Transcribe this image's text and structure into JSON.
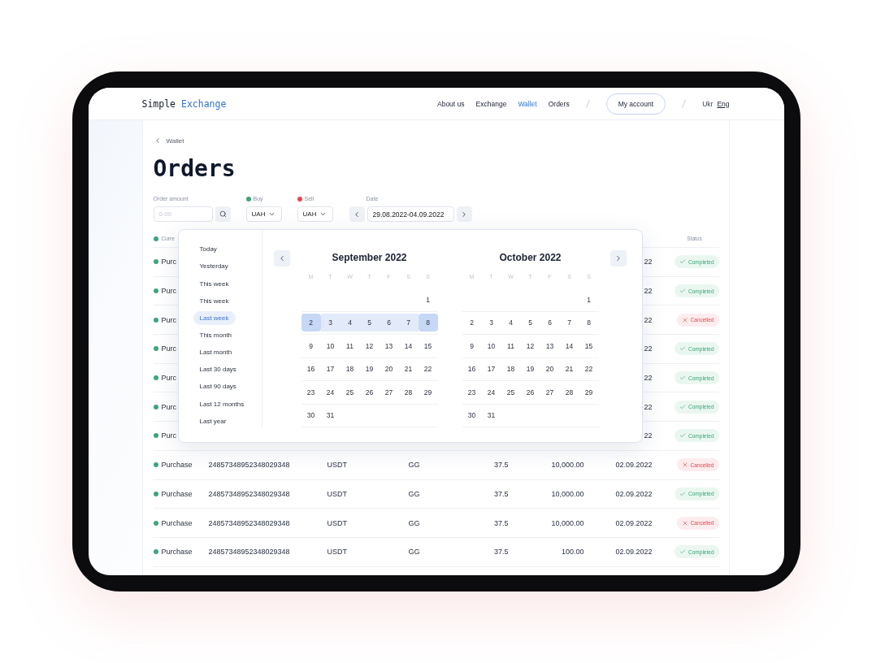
{
  "header": {
    "logo": {
      "first": "Simple",
      "second": "Exchange"
    },
    "nav": [
      {
        "label": "About us",
        "selected": false
      },
      {
        "label": "Exchange",
        "selected": false
      },
      {
        "label": "Wallet",
        "selected": true
      },
      {
        "label": "Orders",
        "selected": false
      }
    ],
    "account_button": "My account",
    "languages": [
      {
        "label": "Ukr",
        "selected": false
      },
      {
        "label": "Eng",
        "selected": true
      }
    ]
  },
  "breadcrumb": "Wallet",
  "title": "Orders",
  "filters": {
    "amount": {
      "label": "Order amount",
      "placeholder": "0.00"
    },
    "currencies": [
      {
        "label": "Buy",
        "value": "UAH",
        "color": "#3fa57c"
      },
      {
        "label": "Sell",
        "value": "UAH",
        "color": "#e5484d"
      }
    ],
    "date": {
      "label": "Date",
      "value": "29.08.2022-04.09.2022"
    }
  },
  "table": {
    "header": {
      "column_1": "Curre",
      "status": "Status"
    },
    "rows": [
      {
        "type": "Purc",
        "date": "22",
        "kind": "completed",
        "status_label": "Completed"
      },
      {
        "type": "Purc",
        "date": "22",
        "kind": "completed",
        "status_label": "Completed"
      },
      {
        "type": "Purc",
        "date": "22",
        "kind": "cancelled",
        "status_label": "Cancelled"
      },
      {
        "type": "Purc",
        "date": "22",
        "kind": "completed",
        "status_label": "Completed"
      },
      {
        "type": "Purc",
        "date": "22",
        "kind": "completed",
        "status_label": "Completed"
      },
      {
        "type": "Purc",
        "date": "22",
        "kind": "completed",
        "status_label": "Completed"
      },
      {
        "type": "Purc",
        "date": "22",
        "kind": "completed",
        "status_label": "Completed"
      },
      {
        "type": "Purchase",
        "id": "24857348952348029348",
        "currency": "USDT",
        "column_4": "GG",
        "rate": "37.5",
        "amount": "10,000.00",
        "date": "02.09.2022",
        "kind": "cancelled",
        "status_label": "Cancelled"
      },
      {
        "type": "Purchase",
        "id": "24857348952348029348",
        "currency": "USDT",
        "column_4": "GG",
        "rate": "37.5",
        "amount": "10,000.00",
        "date": "02.09.2022",
        "kind": "completed",
        "status_label": "Completed"
      },
      {
        "type": "Purchase",
        "id": "24857348952348029348",
        "currency": "USDT",
        "column_4": "GG",
        "rate": "37.5",
        "amount": "10,000.00",
        "date": "02.09.2022",
        "kind": "cancelled",
        "status_label": "Cancelled"
      },
      {
        "type": "Purchase",
        "id": "24857348952348029348",
        "currency": "USDT",
        "column_4": "GG",
        "rate": "37.5",
        "amount": "100.00",
        "date": "02.09.2022",
        "kind": "completed",
        "status_label": "Completed"
      }
    ]
  },
  "date_picker": {
    "presets": [
      {
        "label": "Today",
        "selected": false
      },
      {
        "label": "Yesterday",
        "selected": false
      },
      {
        "label": "This week",
        "selected": false
      },
      {
        "label": "This week",
        "selected": false
      },
      {
        "label": "Last week",
        "selected": true
      },
      {
        "label": "This month",
        "selected": false
      },
      {
        "label": "Last month",
        "selected": false
      },
      {
        "label": "Last 30 days",
        "selected": false
      },
      {
        "label": "Last 90 days",
        "selected": false
      },
      {
        "label": "Last 12 months",
        "selected": false
      },
      {
        "label": "Last year",
        "selected": false
      }
    ],
    "months": [
      {
        "title": "September 2022",
        "weekdays": [
          "M",
          "T",
          "W",
          "T",
          "F",
          "S",
          "S"
        ],
        "weeks": [
          {
            "days": [
              "1"
            ],
            "kind": "first",
            "selected": false
          },
          {
            "days": [
              "2",
              "3",
              "4",
              "5",
              "6",
              "7",
              "8"
            ],
            "kind": "full",
            "selected": true
          },
          {
            "days": [
              "9",
              "10",
              "11",
              "12",
              "13",
              "14",
              "15"
            ],
            "kind": "full",
            "selected": false
          },
          {
            "days": [
              "16",
              "17",
              "18",
              "19",
              "20",
              "21",
              "22"
            ],
            "kind": "full",
            "selected": false
          },
          {
            "days": [
              "23",
              "24",
              "25",
              "26",
              "27",
              "28",
              "29"
            ],
            "kind": "full",
            "selected": false
          },
          {
            "days": [
              "30",
              "31"
            ],
            "kind": "last",
            "selected": false
          }
        ]
      },
      {
        "title": "October 2022",
        "weekdays": [
          "M",
          "T",
          "W",
          "T",
          "F",
          "S",
          "S"
        ],
        "weeks": [
          {
            "days": [
              "1"
            ],
            "kind": "first",
            "selected": false
          },
          {
            "days": [
              "2",
              "3",
              "4",
              "5",
              "6",
              "7",
              "8"
            ],
            "kind": "full",
            "selected": false
          },
          {
            "days": [
              "9",
              "10",
              "11",
              "12",
              "13",
              "14",
              "15"
            ],
            "kind": "full",
            "selected": false
          },
          {
            "days": [
              "16",
              "17",
              "18",
              "19",
              "20",
              "21",
              "22"
            ],
            "kind": "full",
            "selected": false
          },
          {
            "days": [
              "23",
              "24",
              "25",
              "26",
              "27",
              "28",
              "29"
            ],
            "kind": "full",
            "selected": false
          },
          {
            "days": [
              "30",
              "31"
            ],
            "kind": "last",
            "selected": false
          }
        ]
      }
    ]
  }
}
